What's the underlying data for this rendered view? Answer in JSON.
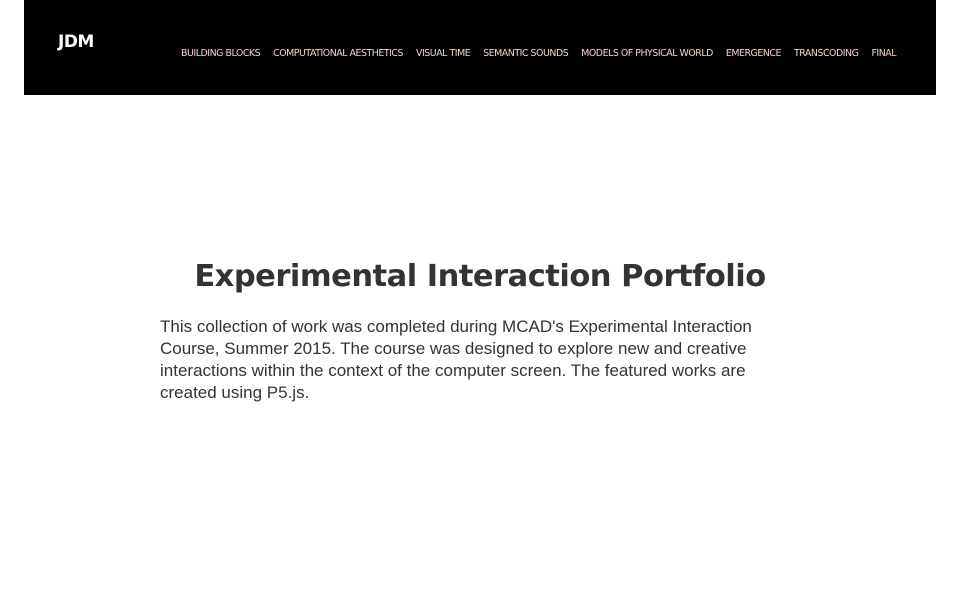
{
  "site": {
    "logo": "JDM"
  },
  "nav": {
    "items": [
      {
        "label": "BUILDING BLOCKS"
      },
      {
        "label": "COMPUTATIONAL AESTHETICS"
      },
      {
        "label": "VISUAL TIME"
      },
      {
        "label": "SEMANTIC SOUNDS"
      },
      {
        "label": "MODELS OF PHYSICAL WORLD"
      },
      {
        "label": "EMERGENCE"
      },
      {
        "label": "TRANSCODING"
      },
      {
        "label": "FINAL"
      }
    ]
  },
  "main": {
    "title": "Experimental Interaction Portfolio",
    "intro": "This collection of work was completed during MCAD's Experimental Interaction Course, Summer 2015. The course was designed to explore new and creative interactions within the context of the computer screen. The featured works are created using P5.js."
  },
  "colors": {
    "navbar_bg": "#000000",
    "nav_link": "#f5d3c8",
    "logo": "#ffffff",
    "text": "#333333",
    "page_bg": "#ffffff"
  }
}
